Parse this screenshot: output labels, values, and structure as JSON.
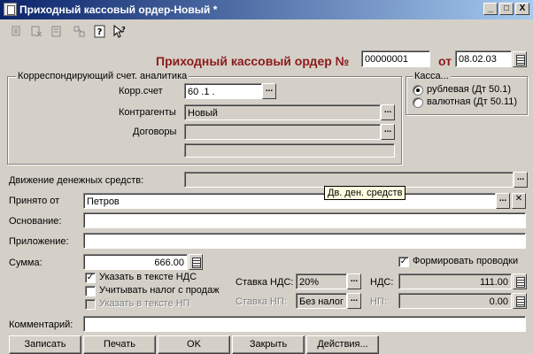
{
  "window": {
    "title": "Приходный кассовый ордер-Новый *",
    "controls": [
      "_",
      "□",
      "X"
    ]
  },
  "header": {
    "doc_title": "Приходный кассовый ордер №",
    "number": "00000001",
    "date_label": "от",
    "date": "08.02.03"
  },
  "corr": {
    "group_title": "Корреспондирующий счет. аналитика",
    "account_label": "Корр.счет",
    "account_value": "60 .1 .",
    "contractor_label": "Контрагенты",
    "contractor_value": "Новый",
    "contracts_label": "Договоры",
    "contracts_value": "",
    "extra_value": ""
  },
  "kassa": {
    "group_title": "Касса...",
    "options": [
      "рублевая (Дт 50.1)",
      "валютная (Дт 50.11)"
    ],
    "selected": 0
  },
  "cashflow": {
    "label": "Движение денежных средств:",
    "value": "",
    "tooltip": "Дв. ден. средств"
  },
  "fields": {
    "received_from_label": "Принято от",
    "received_from_value": "Петров",
    "basis_label": "Основание:",
    "basis_value": "",
    "attachment_label": "Приложение:",
    "attachment_value": "",
    "amount_label": "Сумма:",
    "amount_value": "666.00",
    "comment_label": "Комментарий:",
    "comment_value": ""
  },
  "checks": {
    "vat_in_text": "Указать в тексте НДС",
    "vat_in_text_checked": true,
    "sales_tax": "Учитывать налог с продаж",
    "sales_tax_checked": false,
    "np_in_text": "Указать в тексте НП",
    "np_in_text_checked": false,
    "post_entries": "Формировать проводки",
    "post_entries_checked": true
  },
  "tax": {
    "vat_rate_label": "Ставка НДС:",
    "vat_rate_value": "20%",
    "np_rate_label": "Ставка НП:",
    "np_rate_value": "Без налог",
    "vat_label": "НДС:",
    "vat_value": "111.00",
    "np_label": "НП:",
    "np_value": "0.00"
  },
  "buttons": {
    "save": "Записать",
    "print": "Печать",
    "ok": "OK",
    "close": "Закрыть",
    "actions": "Действия..."
  },
  "toolbar": {
    "icons": [
      "copy-doc-icon",
      "delete-doc-icon",
      "properties-icon",
      "structure-icon",
      "help-icon",
      "context-help-icon"
    ]
  }
}
